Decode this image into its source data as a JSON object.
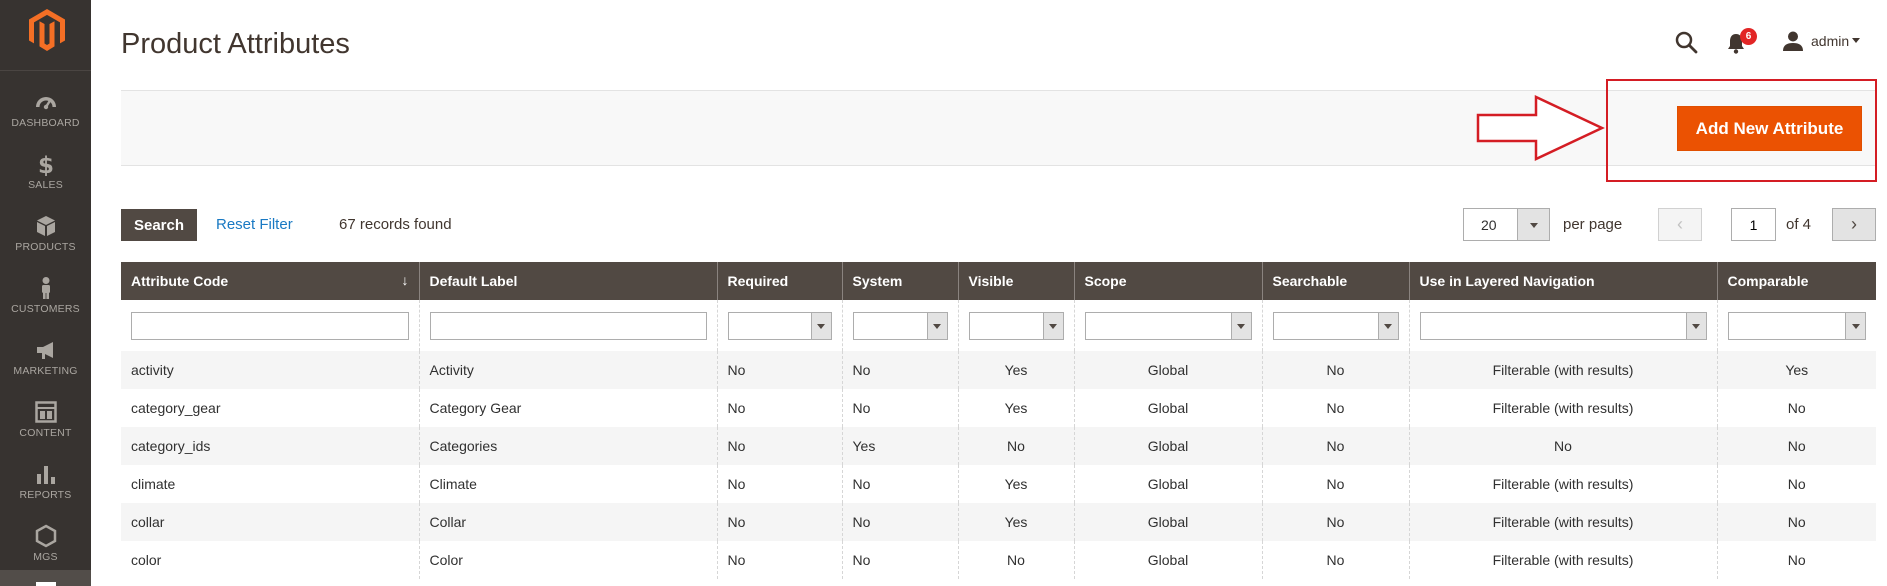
{
  "sidebar": {
    "logo": "magento-logo",
    "items": [
      {
        "label": "DASHBOARD",
        "icon": "dashboard-icon"
      },
      {
        "label": "SALES",
        "icon": "dollar-icon"
      },
      {
        "label": "PRODUCTS",
        "icon": "cube-icon"
      },
      {
        "label": "CUSTOMERS",
        "icon": "person-icon"
      },
      {
        "label": "MARKETING",
        "icon": "megaphone-icon"
      },
      {
        "label": "CONTENT",
        "icon": "layout-icon"
      },
      {
        "label": "REPORTS",
        "icon": "bar-chart-icon"
      },
      {
        "label": "MGS",
        "icon": "hexagon-icon"
      }
    ]
  },
  "header": {
    "title": "Product Attributes",
    "notification_count": "6",
    "user": "admin"
  },
  "actions": {
    "add_new": "Add New Attribute",
    "accent_color": "#eb5202",
    "highlight_color": "#d41d24"
  },
  "toolbar": {
    "search": "Search",
    "reset": "Reset Filter",
    "records": "67 records found",
    "per_page_value": "20",
    "per_page_label": "per page",
    "page": "1",
    "of_pages": "of 4"
  },
  "grid": {
    "columns": [
      "Attribute Code",
      "Default Label",
      "Required",
      "System",
      "Visible",
      "Scope",
      "Searchable",
      "Use in Layered Navigation",
      "Comparable"
    ],
    "rows": [
      [
        "activity",
        "Activity",
        "No",
        "No",
        "Yes",
        "Global",
        "No",
        "Filterable (with results)",
        "Yes"
      ],
      [
        "category_gear",
        "Category Gear",
        "No",
        "No",
        "Yes",
        "Global",
        "No",
        "Filterable (with results)",
        "No"
      ],
      [
        "category_ids",
        "Categories",
        "No",
        "Yes",
        "No",
        "Global",
        "No",
        "No",
        "No"
      ],
      [
        "climate",
        "Climate",
        "No",
        "No",
        "Yes",
        "Global",
        "No",
        "Filterable (with results)",
        "No"
      ],
      [
        "collar",
        "Collar",
        "No",
        "No",
        "Yes",
        "Global",
        "No",
        "Filterable (with results)",
        "No"
      ],
      [
        "color",
        "Color",
        "No",
        "No",
        "No",
        "Global",
        "No",
        "Filterable (with results)",
        "No"
      ]
    ]
  }
}
